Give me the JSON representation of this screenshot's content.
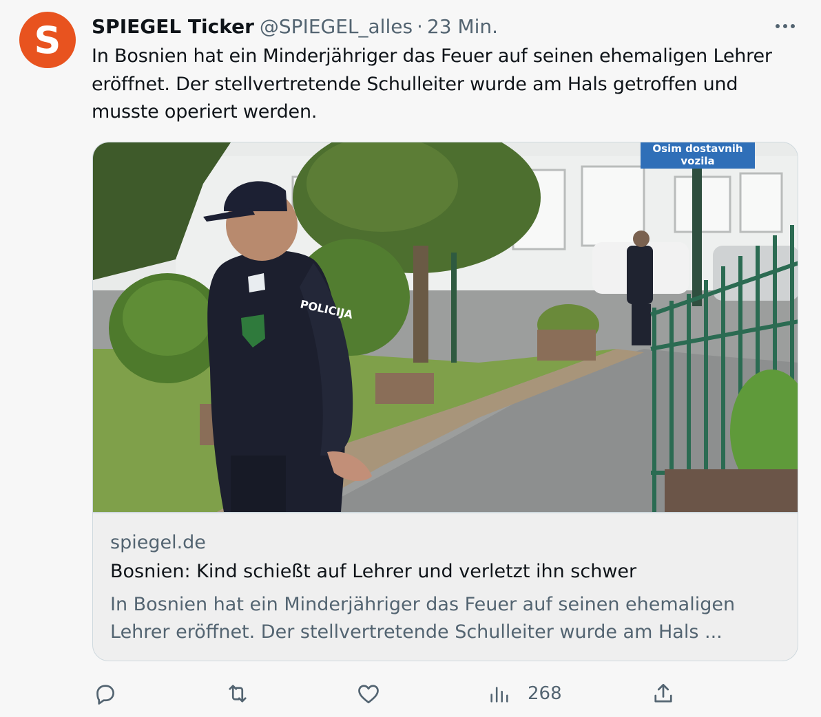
{
  "tweet": {
    "author_name": "SPIEGEL Ticker",
    "handle": "@SPIEGEL_alles",
    "separator": "·",
    "time": "23 Min.",
    "avatar_letter": "S",
    "text_lines": [
      "In Bosnien hat ein Minderjähriger das Feuer auf seinen ehemaligen Lehrer",
      "eröffnet. Der stellvertretende Schulleiter wurde am Hals getroffen und",
      "musste operiert werden."
    ]
  },
  "card": {
    "sign_lines": [
      "Osim dostavnih",
      "vozila"
    ],
    "uniform_text": "POLICIJA",
    "domain": "spiegel.de",
    "title": "Bosnien: Kind schießt auf Lehrer und verletzt ihn schwer",
    "description_lines": [
      "In Bosnien hat ein Minderjähriger das Feuer auf seinen ehemaligen",
      "Lehrer eröffnet. Der stellvertretende Schulleiter wurde am Hals ..."
    ]
  },
  "actions": {
    "reply_icon": "reply-icon",
    "retweet_icon": "retweet-icon",
    "like_icon": "heart-icon",
    "views_icon": "bar-chart-icon",
    "views_count": "268",
    "share_icon": "share-icon"
  },
  "colors": {
    "brand": "#e8531f",
    "text_primary": "#0f1419",
    "text_secondary": "#536471",
    "border": "#cfd9de",
    "background": "#f7f7f7"
  }
}
